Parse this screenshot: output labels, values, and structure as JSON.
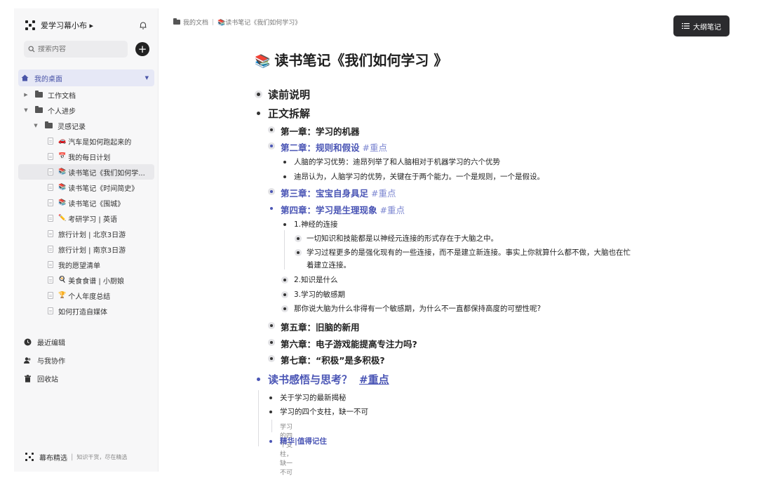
{
  "sidebar": {
    "workspace_name": "爱学习幕小布 ▸",
    "search_placeholder": "搜索内容",
    "add_label": "+",
    "desk_label": "我的桌面",
    "tree": [
      {
        "label": "工作文档",
        "type": "folder"
      },
      {
        "label": "个人进步",
        "type": "folder"
      },
      {
        "label": "灵感记录",
        "type": "folder"
      },
      {
        "label": "汽车是如何跑起来的",
        "type": "doc",
        "emoji": "🚗"
      },
      {
        "label": "我的每日计划",
        "type": "doc",
        "emoji": "📅"
      },
      {
        "label": "读书笔记《我们如何学...",
        "type": "doc",
        "emoji": "📚"
      },
      {
        "label": "读书笔记《时间简史》",
        "type": "doc",
        "emoji": "📚"
      },
      {
        "label": "读书笔记《围城》",
        "type": "doc",
        "emoji": "📚"
      },
      {
        "label": "考研学习 | 英语",
        "type": "doc",
        "emoji": "✏️"
      },
      {
        "label": "旅行计划 | 北京3日游",
        "type": "doc",
        "emoji": ""
      },
      {
        "label": "旅行计划 | 南京3日游",
        "type": "doc",
        "emoji": ""
      },
      {
        "label": "我的愿望清单",
        "type": "doc",
        "emoji": ""
      },
      {
        "label": "美食食谱 | 小厨娘",
        "type": "doc",
        "emoji": "🍳"
      },
      {
        "label": "个人年度总结",
        "type": "doc",
        "emoji": "🏆"
      },
      {
        "label": "如何打造自媒体",
        "type": "doc",
        "emoji": ""
      }
    ],
    "misc": [
      {
        "label": "最近编辑"
      },
      {
        "label": "与我协作"
      },
      {
        "label": "回收站"
      }
    ],
    "footer": {
      "brand": "幕布精选",
      "slogan": "知识干货，尽在精选"
    }
  },
  "breadcrumb": {
    "root": "我的文档",
    "current": "📚读书笔记《我们如何学习》"
  },
  "outline_button": "大纲笔记",
  "doc": {
    "title_emoji": "📚",
    "title": "读书笔记《我们如何学习 》",
    "nodes": {
      "pre": "读前说明",
      "main": "正文拆解",
      "ch1": "第一章：学习的机器",
      "ch2": "第二章：规则和假设",
      "ch2_tag": "#重点",
      "ch2_a": "人脑的学习优势：迪昂列举了和人脑相对于机器学习的六个优势",
      "ch2_b": "迪昂认为，人脑学习的优势，关键在于两个能力。一个是规则，一个是假设。",
      "ch3": "第三章：宝宝自身具足",
      "ch3_tag": "#重点",
      "ch4": "第四章：学习是生理现象",
      "ch4_tag": "#重点",
      "ch4_1": "1.神经的连接",
      "ch4_1a": "一切知识和技能都是以神经元连接的形式存在于大脑之中。",
      "ch4_1b_1": "学习过程更多的是强化现有的一些连接，而不是建立新连接。事实上你就算什么都不做，大脑也在忙",
      "ch4_1b_2": "着建立连接。",
      "ch4_2": "2.知识是什么",
      "ch4_3": "3.学习的敏感期",
      "ch4_4": "那你说大脑为什么非得有一个敏感期，为什么不一直都保持高度的可塑性呢?",
      "ch5": "第五章：旧脑的新用",
      "ch6": "第六章：电子游戏能提高专注力吗?",
      "ch7": "第七章：“积极”是多积极?",
      "reflect": "读书感悟与思考？",
      "reflect_tag": "#重点",
      "r1": "关于学习的最新揭秘",
      "r2": "学习的四个支柱，缺一不可",
      "r2_note": "学习的四个支柱，缺一不可",
      "r3": "精华|值得记住"
    }
  },
  "colors": {
    "accent": "#4a55b5",
    "tag": "#7a84d0",
    "dark_button": "#2b2b2e",
    "sidebar_bg": "#f7f7f8"
  }
}
